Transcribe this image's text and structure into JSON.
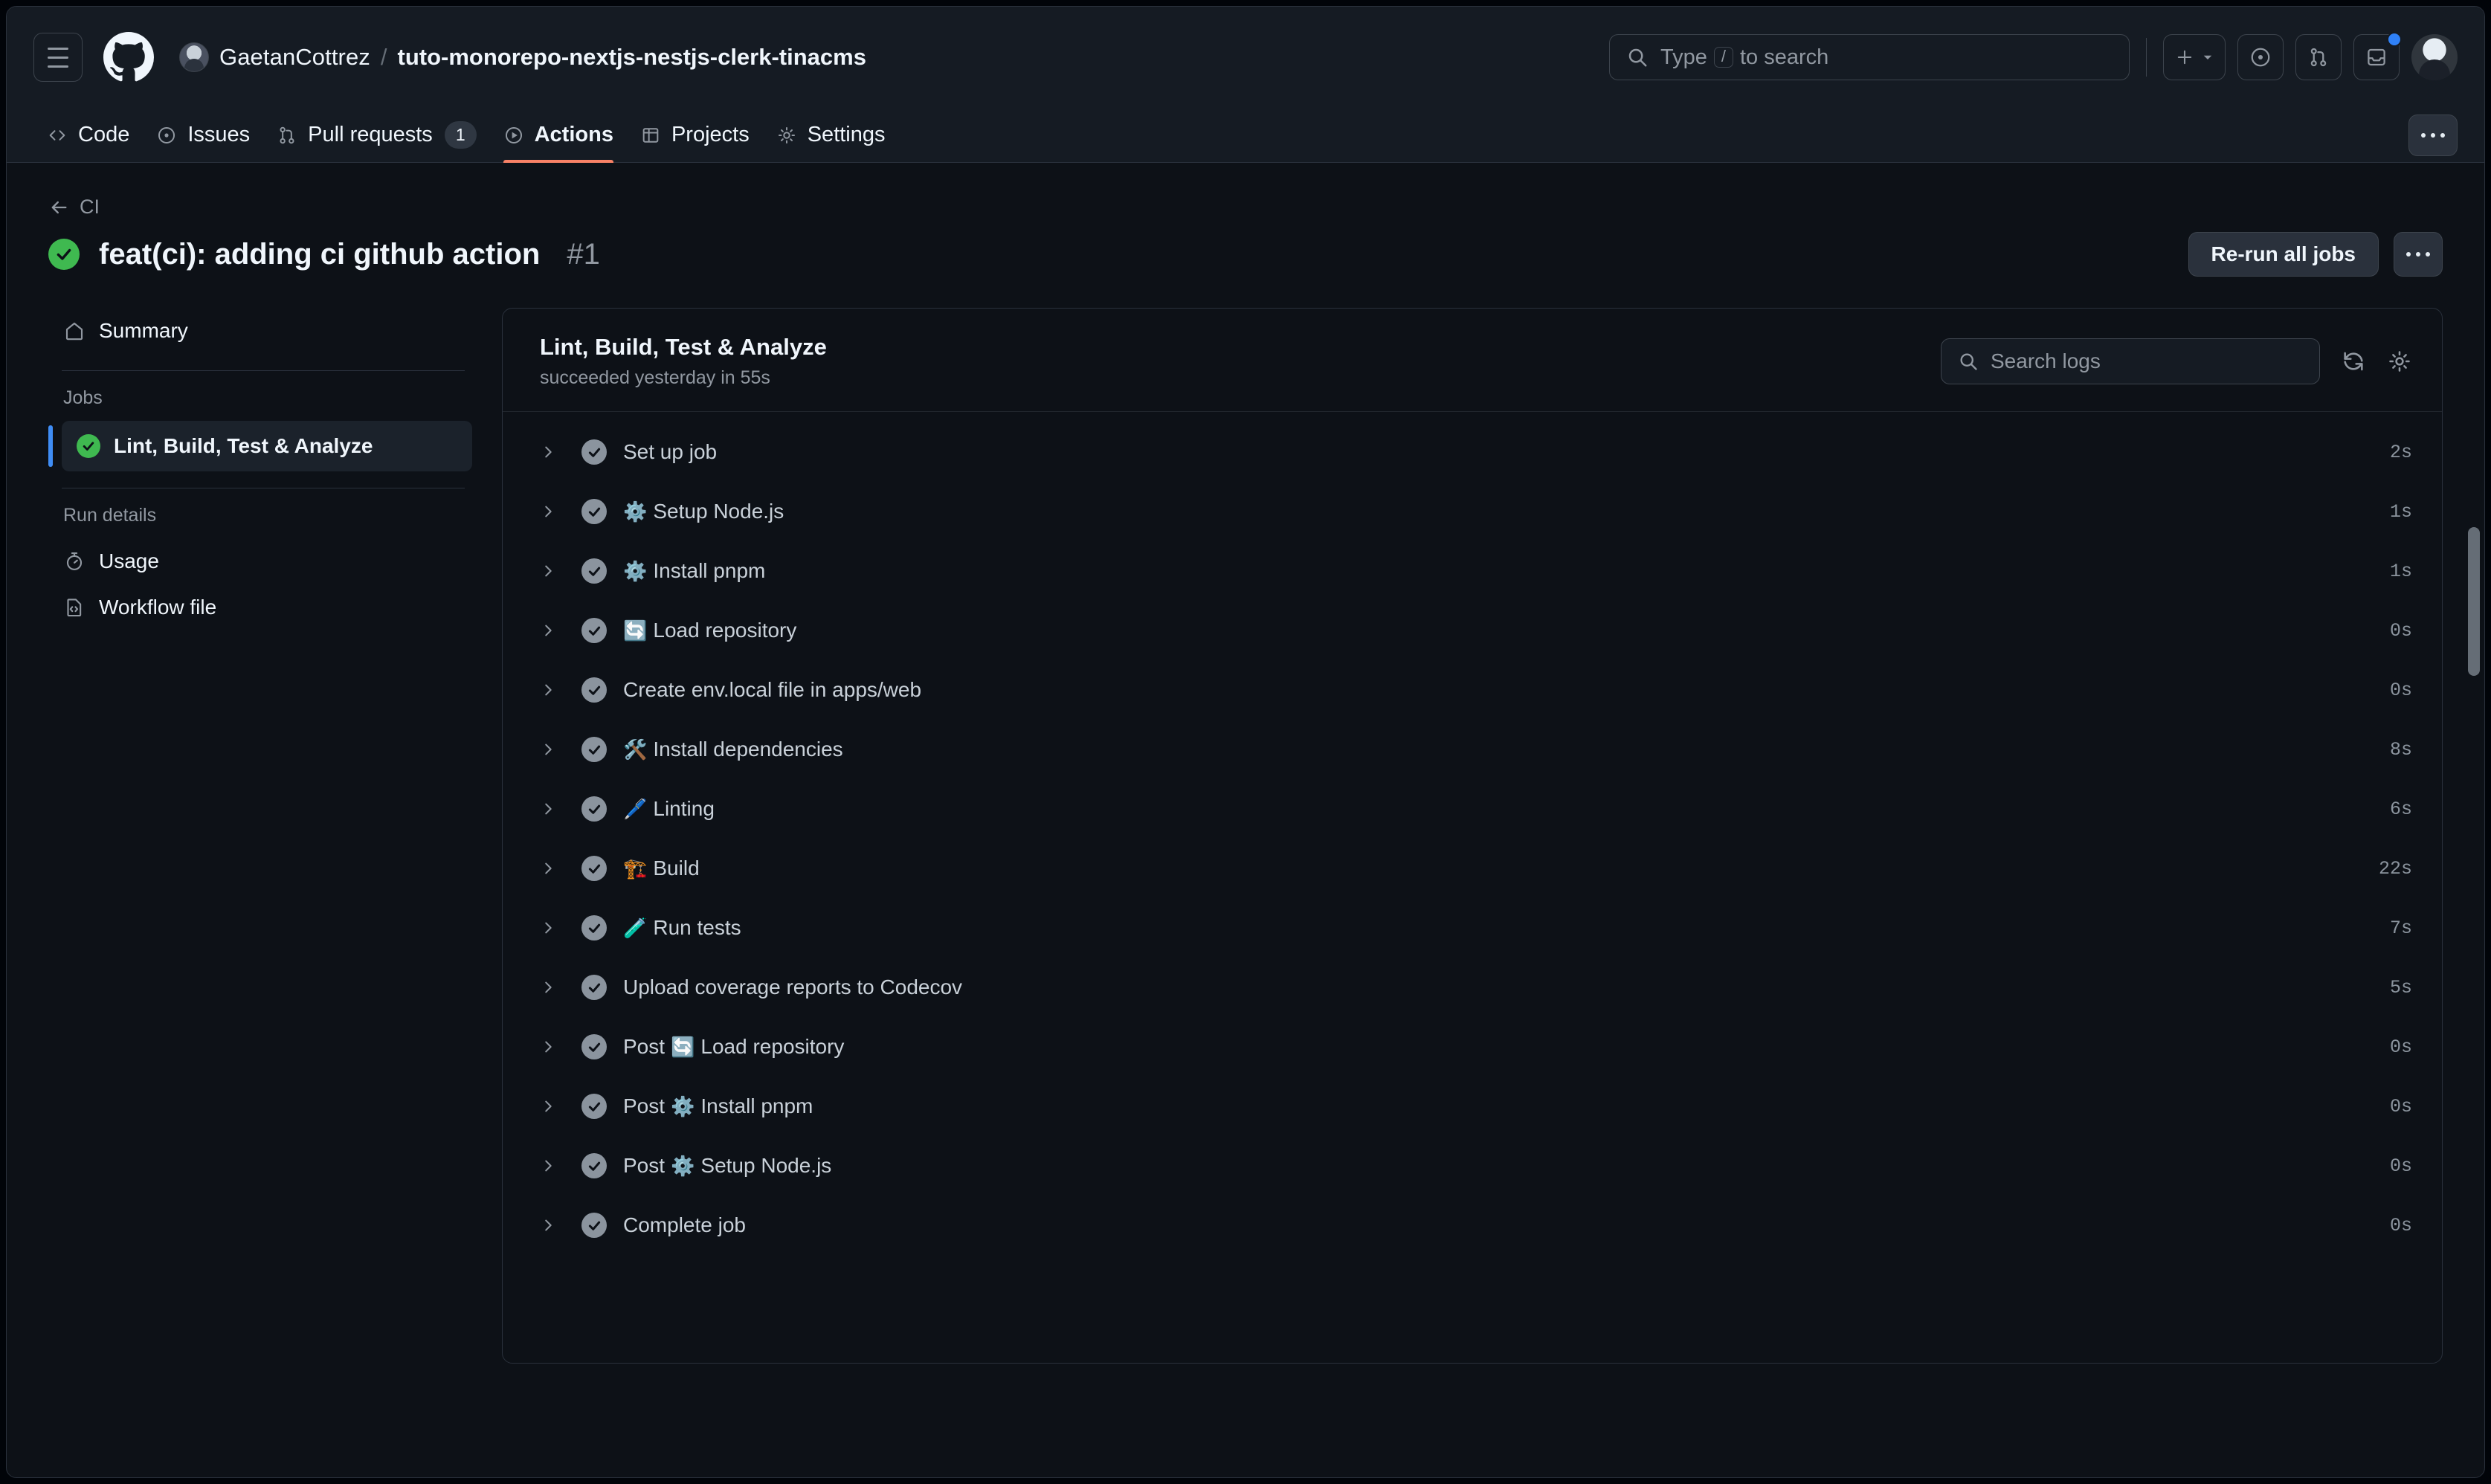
{
  "header": {
    "menu_label": "menu",
    "owner": "GaetanCottrez",
    "separator": "/",
    "repo": "tuto-monorepo-nextjs-nestjs-clerk-tinacms",
    "search_placeholder": "Type",
    "search_key": "/",
    "search_suffix": "to search",
    "icons": [
      "plus-icon",
      "chevron-down-icon",
      "issues-icon",
      "pull-request-icon",
      "inbox-icon",
      "avatar"
    ]
  },
  "repo_nav": {
    "items": [
      {
        "label": "Code",
        "icon": "code-icon",
        "active": false,
        "count": null
      },
      {
        "label": "Issues",
        "icon": "issue-opened-icon",
        "active": false,
        "count": null
      },
      {
        "label": "Pull requests",
        "icon": "git-pull-request-icon",
        "active": false,
        "count": "1"
      },
      {
        "label": "Actions",
        "icon": "play-icon",
        "active": true,
        "count": null
      },
      {
        "label": "Projects",
        "icon": "table-icon",
        "active": false,
        "count": null
      },
      {
        "label": "Settings",
        "icon": "gear-icon",
        "active": false,
        "count": null
      }
    ],
    "more_label": "more-options"
  },
  "run": {
    "back_label": "CI",
    "title": "feat(ci): adding ci github action",
    "number": "#1",
    "status": "success",
    "rerun_label": "Re-run all jobs",
    "more_label": "more-options"
  },
  "sidebar": {
    "summary_label": "Summary",
    "jobs_heading": "Jobs",
    "jobs": [
      {
        "label": "Lint, Build, Test & Analyze",
        "status": "success",
        "active": true
      }
    ],
    "run_details_heading": "Run details",
    "run_details": [
      {
        "label": "Usage",
        "icon": "stopwatch-icon"
      },
      {
        "label": "Workflow file",
        "icon": "workflow-file-icon"
      }
    ]
  },
  "log_panel": {
    "title": "Lint, Build, Test & Analyze",
    "subtitle": "succeeded yesterday in 55s",
    "search_placeholder": "Search logs",
    "refresh_label": "refresh-logs",
    "settings_label": "log-settings",
    "steps": [
      {
        "emoji": "",
        "label": "Set up job",
        "duration": "2s",
        "status": "success"
      },
      {
        "emoji": "⚙️",
        "label": "Setup Node.js",
        "duration": "1s",
        "status": "success"
      },
      {
        "emoji": "⚙️",
        "label": "Install pnpm",
        "duration": "1s",
        "status": "success"
      },
      {
        "emoji": "🔄",
        "label": "Load repository",
        "duration": "0s",
        "status": "success"
      },
      {
        "emoji": "",
        "label": "Create env.local file in apps/web",
        "duration": "0s",
        "status": "success"
      },
      {
        "emoji": "🛠️",
        "label": "Install dependencies",
        "duration": "8s",
        "status": "success"
      },
      {
        "emoji": "🖊️",
        "label": "Linting",
        "duration": "6s",
        "status": "success"
      },
      {
        "emoji": "🏗️",
        "label": "Build",
        "duration": "22s",
        "status": "success"
      },
      {
        "emoji": "🧪",
        "label": "Run tests",
        "duration": "7s",
        "status": "success"
      },
      {
        "emoji": "",
        "label": "Upload coverage reports to Codecov",
        "duration": "5s",
        "status": "success"
      },
      {
        "emoji": "🔄",
        "label": "Post Load repository",
        "duration": "0s",
        "status": "success",
        "prefix": "Post"
      },
      {
        "emoji": "⚙️",
        "label": "Post Install pnpm",
        "duration": "0s",
        "status": "success",
        "prefix": "Post"
      },
      {
        "emoji": "⚙️",
        "label": "Post Setup Node.js",
        "duration": "0s",
        "status": "success",
        "prefix": "Post"
      },
      {
        "emoji": "",
        "label": "Complete job",
        "duration": "0s",
        "status": "success"
      }
    ]
  },
  "colors": {
    "page_bg": "#0d1117",
    "header_bg": "#151b23",
    "border": "#2a313c",
    "text": "#f0f6fc",
    "muted": "#9198a1",
    "success_green": "#3fb950",
    "accent_blue": "#3f8df5",
    "active_tab_orange": "#f78166"
  }
}
